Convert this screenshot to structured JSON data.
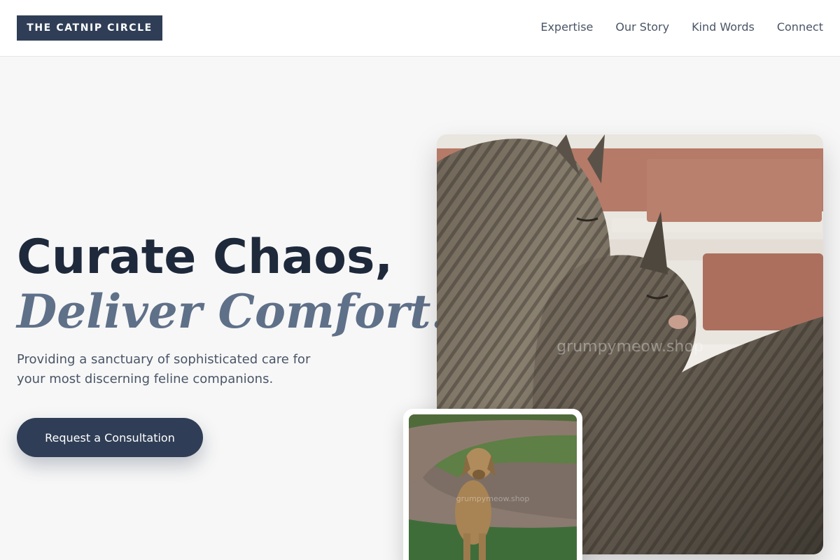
{
  "brand": {
    "name": "THE CATNIP CIRCLE"
  },
  "nav": {
    "items": [
      "Expertise",
      "Our Story",
      "Kind Words",
      "Connect"
    ]
  },
  "hero": {
    "title_line1": "Curate Chaos,",
    "title_line2": "Deliver Comfort.",
    "subtitle": "Providing a sanctuary of sophisticated care for your most discerning feline companions.",
    "cta_label": "Request a Consultation"
  },
  "images": {
    "main": {
      "subject": "two tabby cats cuddling in front of a brick wall",
      "watermark": "grumpymeow.shop"
    },
    "secondary": {
      "subject": "golden dog sitting on grass by a brick path",
      "watermark": "grumpymeow.shop"
    }
  },
  "colors": {
    "primary": "#2f3e56",
    "heading": "#1e293b",
    "accent_text": "#5f7089",
    "body_text": "#4a5567",
    "background": "#f7f7f7"
  }
}
